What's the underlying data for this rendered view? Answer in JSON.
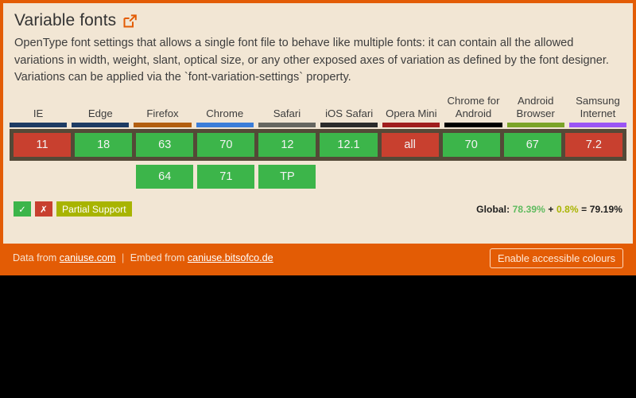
{
  "widget": {
    "title": "Variable fonts",
    "external_link_icon": "external-link-icon",
    "description": "OpenType font settings that allows a single font file to behave like multiple fonts: it can contain all the allowed variations in width, weight, slant, optical size, or any other exposed axes of variation as defined by the font designer. Variations can be applied via the `font-variation-settings` property.",
    "accent_color": "#e35c05",
    "background_color": "#f2e6d4"
  },
  "table": {
    "browsers": [
      {
        "name": "IE",
        "accent": "#1e3c64"
      },
      {
        "name": "Edge",
        "accent": "#1e3c64"
      },
      {
        "name": "Firefox",
        "accent": "#b35f10"
      },
      {
        "name": "Chrome",
        "accent": "#3b7dd8"
      },
      {
        "name": "Safari",
        "accent": "#666660"
      },
      {
        "name": "iOS Safari",
        "accent": "#2b2b2b"
      },
      {
        "name": "Opera Mini",
        "accent": "#a01e1e"
      },
      {
        "name": "Chrome for Android",
        "accent": "#000000"
      },
      {
        "name": "Android Browser",
        "accent": "#7ba428"
      },
      {
        "name": "Samsung Internet",
        "accent": "#9b55f5"
      }
    ],
    "current_row": [
      {
        "version": "11",
        "support": "n"
      },
      {
        "version": "18",
        "support": "y"
      },
      {
        "version": "63",
        "support": "y"
      },
      {
        "version": "70",
        "support": "y"
      },
      {
        "version": "12",
        "support": "y"
      },
      {
        "version": "12.1",
        "support": "y"
      },
      {
        "version": "all",
        "support": "n"
      },
      {
        "version": "70",
        "support": "y"
      },
      {
        "version": "67",
        "support": "y"
      },
      {
        "version": "7.2",
        "support": "n"
      }
    ],
    "future_row": [
      {
        "version": "",
        "support": "blank"
      },
      {
        "version": "",
        "support": "blank"
      },
      {
        "version": "64",
        "support": "y"
      },
      {
        "version": "71",
        "support": "y"
      },
      {
        "version": "TP",
        "support": "y"
      },
      {
        "version": "",
        "support": "blank"
      },
      {
        "version": "",
        "support": "blank"
      },
      {
        "version": "",
        "support": "blank"
      },
      {
        "version": "",
        "support": "blank"
      },
      {
        "version": "",
        "support": "blank"
      }
    ],
    "colors": {
      "supported": "#3cb54a",
      "unsupported": "#c8402f",
      "partial": "#a8b400",
      "frame": "#544937"
    }
  },
  "legend": {
    "supported_label": "✓",
    "unsupported_label": "✗",
    "partial_label": "Partial Support"
  },
  "stats": {
    "prefix": "Global:",
    "full": "78.39%",
    "plus": "+",
    "partial": "0.8%",
    "equals": "=",
    "total": "79.19%"
  },
  "footer": {
    "data_from_label": "Data from",
    "data_link": "caniuse.com",
    "separator": "|",
    "embed_from_label": "Embed from",
    "embed_link": "caniuse.bitsofco.de",
    "accessible_button": "Enable accessible colours"
  }
}
